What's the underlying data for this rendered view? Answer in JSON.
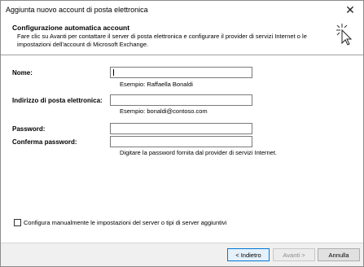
{
  "window": {
    "title": "Aggiunta nuovo account di posta elettronica",
    "close_glyph": "✕"
  },
  "header": {
    "title": "Configurazione automatica account",
    "description": "Fare clic su Avanti per contattare il server di posta elettronica e configurare il provider di servizi Internet o le impostazioni dell'account di Microsoft Exchange.",
    "icon": "wizard-cursor-icon"
  },
  "form": {
    "name": {
      "label": "Nome:",
      "value": "",
      "hint": "Esempio: Raffaella Bonaldi"
    },
    "email": {
      "label": "Indirizzo di posta elettronica:",
      "value": "",
      "hint": "Esempio: bonaldi@contoso.com"
    },
    "password": {
      "label": "Password:",
      "value": ""
    },
    "confirm": {
      "label": "Conferma password:",
      "value": "",
      "hint": "Digitare la password fornita dal provider di servizi Internet."
    }
  },
  "manual": {
    "label": "Configura manualmente le impostazioni del server o tipi di server aggiuntivi",
    "checked": false
  },
  "buttons": {
    "back": "< Indietro",
    "next": "Avanti >",
    "cancel": "Annulla"
  }
}
